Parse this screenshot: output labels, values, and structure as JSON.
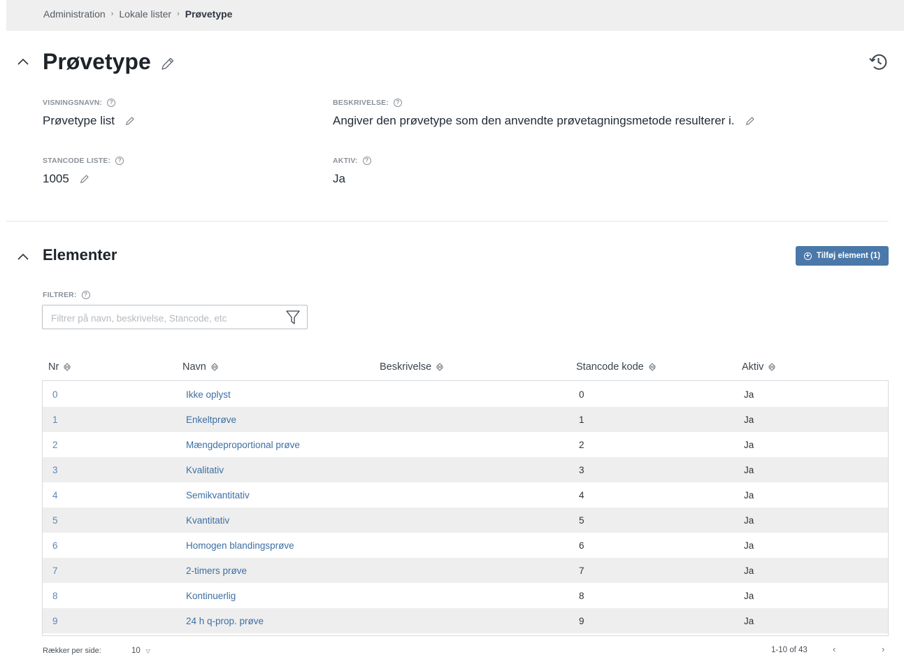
{
  "breadcrumb": {
    "items": [
      "Administration",
      "Lokale lister"
    ],
    "current": "Prøvetype"
  },
  "header": {
    "title": "Prøvetype",
    "icons": [
      "chevron-up-icon",
      "pencil-icon",
      "history-icon"
    ]
  },
  "fields": {
    "visningsnavn": {
      "label": "VISNINGSNAVN:",
      "value": "Prøvetype list"
    },
    "beskrivelse": {
      "label": "BESKRIVELSE:",
      "value": "Angiver den prøvetype som den anvendte prøvetagningsmetode resulterer i."
    },
    "stancode": {
      "label": "STANCODE LISTE:",
      "value": "1005"
    },
    "aktiv": {
      "label": "AKTIV:",
      "value": "Ja"
    }
  },
  "elements": {
    "title": "Elementer",
    "add_button": "Tilføj element (1)",
    "filter_label": "FILTRER:",
    "filter_placeholder": "Filtrer på navn, beskrivelse, Stancode, etc",
    "columns": [
      "Nr",
      "Navn",
      "Beskrivelse",
      "Stancode kode",
      "Aktiv"
    ],
    "rows": [
      {
        "nr": "0",
        "navn": "Ikke oplyst",
        "beskrivelse": "",
        "stancode": "0",
        "aktiv": "Ja"
      },
      {
        "nr": "1",
        "navn": "Enkeltprøve",
        "beskrivelse": "",
        "stancode": "1",
        "aktiv": "Ja"
      },
      {
        "nr": "2",
        "navn": "Mængdeproportional prøve",
        "beskrivelse": "",
        "stancode": "2",
        "aktiv": "Ja"
      },
      {
        "nr": "3",
        "navn": "Kvalitativ",
        "beskrivelse": "",
        "stancode": "3",
        "aktiv": "Ja"
      },
      {
        "nr": "4",
        "navn": "Semikvantitativ",
        "beskrivelse": "",
        "stancode": "4",
        "aktiv": "Ja"
      },
      {
        "nr": "5",
        "navn": "Kvantitativ",
        "beskrivelse": "",
        "stancode": "5",
        "aktiv": "Ja"
      },
      {
        "nr": "6",
        "navn": "Homogen blandingsprøve",
        "beskrivelse": "",
        "stancode": "6",
        "aktiv": "Ja"
      },
      {
        "nr": "7",
        "navn": "2-timers prøve",
        "beskrivelse": "",
        "stancode": "7",
        "aktiv": "Ja"
      },
      {
        "nr": "8",
        "navn": "Kontinuerlig",
        "beskrivelse": "",
        "stancode": "8",
        "aktiv": "Ja"
      },
      {
        "nr": "9",
        "navn": "24 h q-prop. prøve",
        "beskrivelse": "",
        "stancode": "9",
        "aktiv": "Ja"
      }
    ]
  },
  "pagination": {
    "rows_per_page_label": "Rækker per side:",
    "rows_per_page": "10",
    "range": "1-10 of 43",
    "prev": "‹",
    "next": "›"
  },
  "colors": {
    "accent": "#4a78a8",
    "link": "#3d6fa3",
    "stripe": "#eeeeee",
    "breadcrumb_bg": "#efefef"
  }
}
